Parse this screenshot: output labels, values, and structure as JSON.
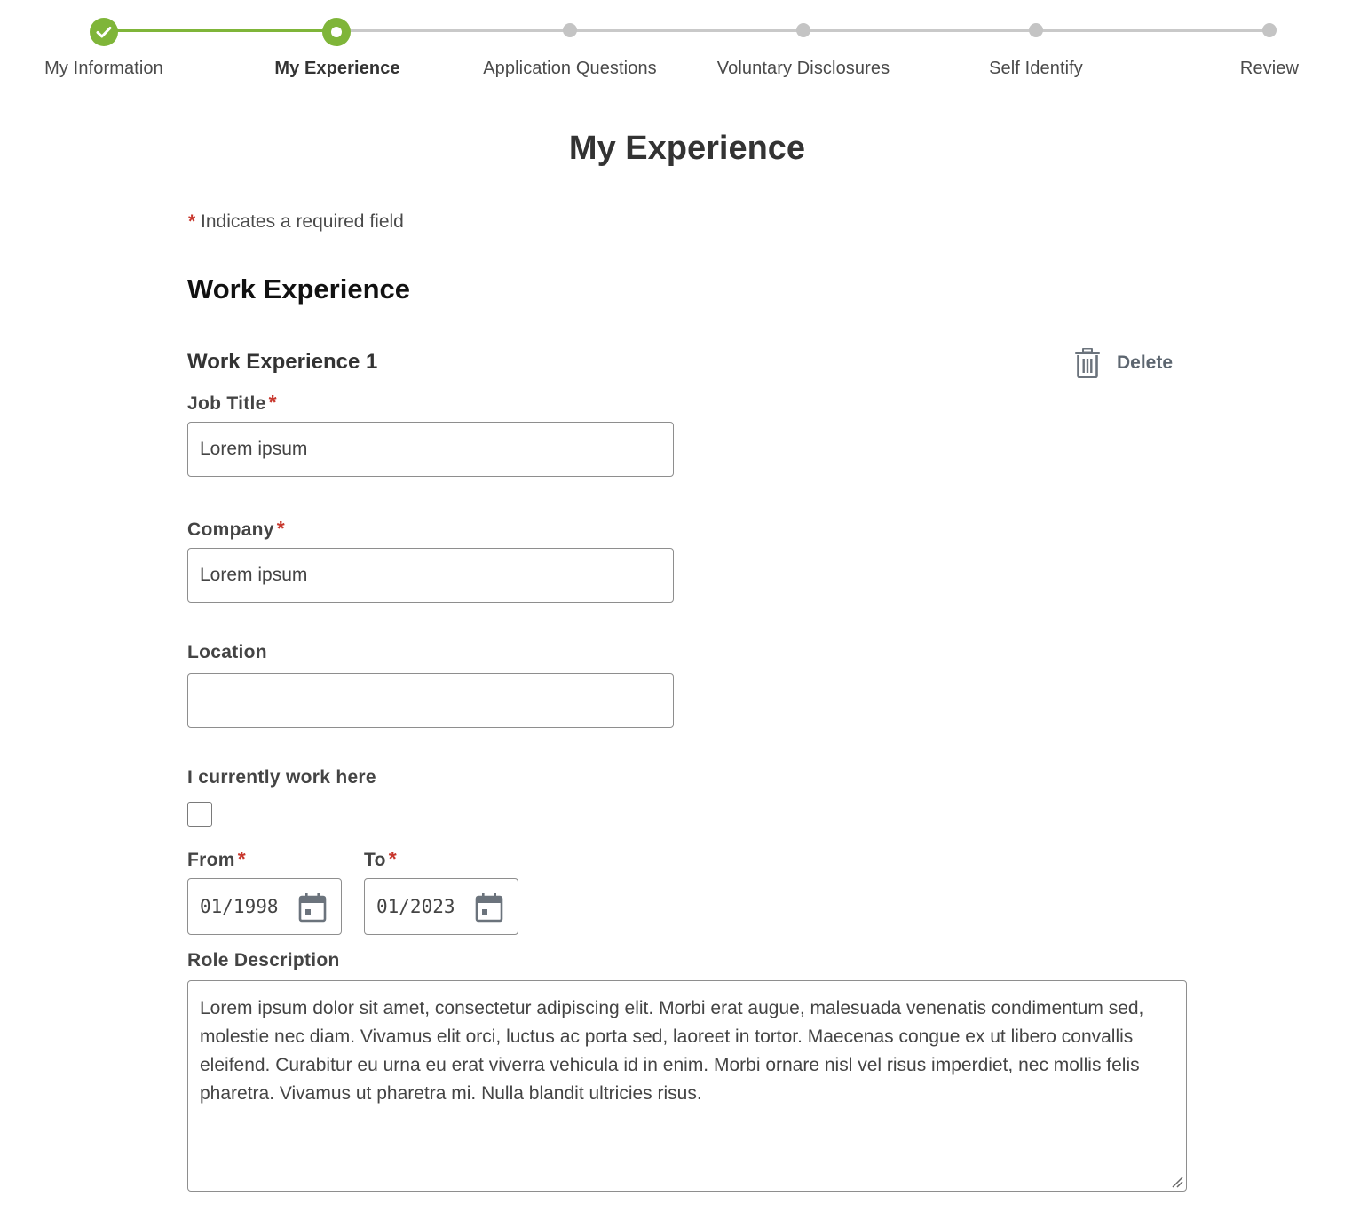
{
  "stepper": {
    "steps": [
      {
        "label": "My Information",
        "state": "complete"
      },
      {
        "label": "My Experience",
        "state": "current"
      },
      {
        "label": "Application Questions",
        "state": "upcoming"
      },
      {
        "label": "Voluntary Disclosures",
        "state": "upcoming"
      },
      {
        "label": "Self Identify",
        "state": "upcoming"
      },
      {
        "label": "Review",
        "state": "upcoming"
      }
    ],
    "colors": {
      "complete": "#7fb539",
      "upcoming": "#c4c4c4"
    }
  },
  "page": {
    "title": "My Experience",
    "required_star": "*",
    "required_note": "Indicates a required field"
  },
  "work_experience": {
    "section_title": "Work Experience",
    "item_title": "Work Experience 1",
    "delete_label": "Delete",
    "job_title": {
      "label": "Job Title",
      "required": "*",
      "value": "Lorem ipsum"
    },
    "company": {
      "label": "Company",
      "required": "*",
      "value": "Lorem ipsum"
    },
    "location": {
      "label": "Location",
      "value": ""
    },
    "currently_work_here": {
      "label": "I currently work here",
      "checked": false
    },
    "from": {
      "label": "From",
      "required": "*",
      "value": "01/1998"
    },
    "to": {
      "label": "To",
      "required": "*",
      "value": "01/2023"
    },
    "role_description": {
      "label": "Role Description",
      "value": "Lorem ipsum dolor sit amet, consectetur adipiscing elit. Morbi erat augue, malesuada venenatis condimentum sed, molestie nec diam. Vivamus elit orci, luctus ac porta sed, laoreet in tortor. Maecenas congue ex ut libero convallis eleifend. Curabitur eu urna eu erat viverra vehicula id in enim. Morbi ornare nisl vel risus imperdiet, nec mollis felis pharetra. Vivamus ut pharetra mi. Nulla blandit ultricies risus."
    }
  },
  "icons": {
    "check": "check-icon",
    "delete": "trash-icon",
    "calendar": "calendar-icon"
  },
  "colors": {
    "accent": "#7fb539",
    "required": "#c8372d"
  }
}
